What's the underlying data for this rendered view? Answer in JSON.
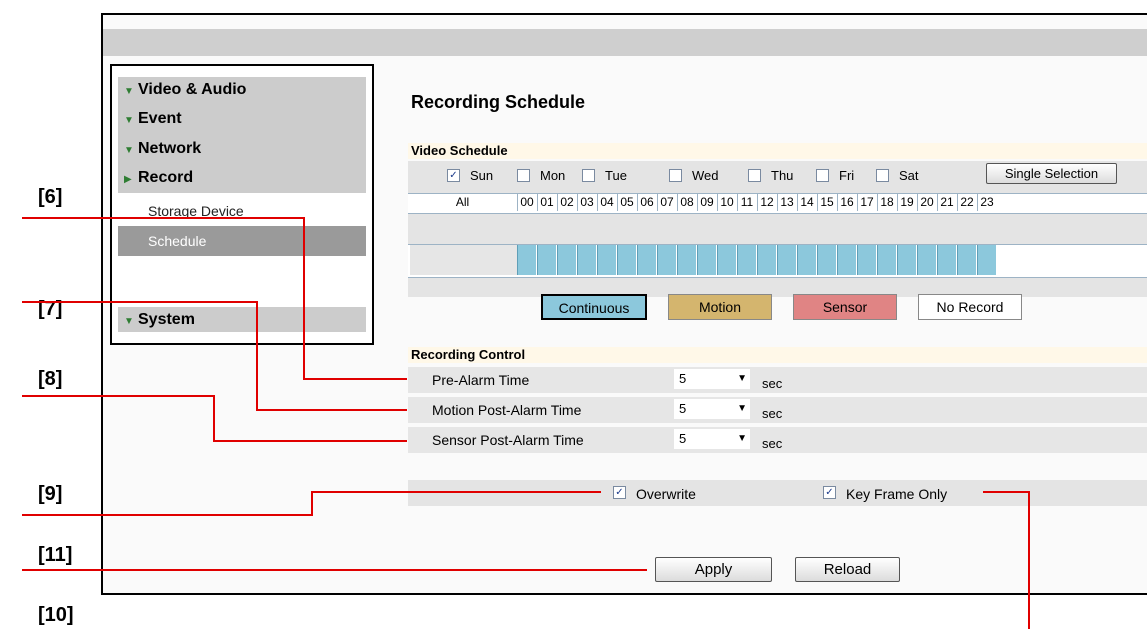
{
  "sidebar": {
    "items": [
      {
        "label": "Video & Audio",
        "icon": "triangle-down-icon"
      },
      {
        "label": "Event",
        "icon": "triangle-down-icon"
      },
      {
        "label": "Network",
        "icon": "triangle-down-icon"
      },
      {
        "label": "Record",
        "icon": "triangle-right-icon"
      },
      {
        "label": "System",
        "icon": "triangle-down-icon"
      }
    ],
    "sub_items": [
      "Storage Device",
      "Schedule"
    ]
  },
  "page": {
    "title": "Recording Schedule"
  },
  "video_schedule": {
    "header": "Video Schedule",
    "days": [
      {
        "label": "Sun",
        "checked": true
      },
      {
        "label": "Mon",
        "checked": false
      },
      {
        "label": "Tue",
        "checked": false
      },
      {
        "label": "Wed",
        "checked": false
      },
      {
        "label": "Thu",
        "checked": false
      },
      {
        "label": "Fri",
        "checked": false
      },
      {
        "label": "Sat",
        "checked": false
      }
    ],
    "single_selection_label": "Single Selection",
    "all_label": "All",
    "hours": [
      "00",
      "01",
      "02",
      "03",
      "04",
      "05",
      "06",
      "07",
      "08",
      "09",
      "10",
      "11",
      "12",
      "13",
      "14",
      "15",
      "16",
      "17",
      "18",
      "19",
      "20",
      "21",
      "22",
      "23"
    ],
    "modes": [
      {
        "label": "Continuous",
        "color": "#8cc8dc",
        "selected": true
      },
      {
        "label": "Motion",
        "color": "#d4b56e",
        "selected": false
      },
      {
        "label": "Sensor",
        "color": "#e08484",
        "selected": false
      },
      {
        "label": "No Record",
        "color": "#ffffff",
        "selected": false
      }
    ]
  },
  "recording_control": {
    "header": "Recording Control",
    "rows": [
      {
        "label": "Pre-Alarm Time",
        "value": "5",
        "unit": "sec"
      },
      {
        "label": "Motion Post-Alarm Time",
        "value": "5",
        "unit": "sec"
      },
      {
        "label": "Sensor Post-Alarm Time",
        "value": "5",
        "unit": "sec"
      }
    ],
    "overwrite_label": "Overwrite",
    "overwrite_checked": true,
    "keyframe_label": "Key Frame Only",
    "keyframe_checked": true
  },
  "buttons": {
    "apply": "Apply",
    "reload": "Reload"
  },
  "callouts": [
    "[6]",
    "[7]",
    "[8]",
    "[9]",
    "[11]",
    "[10]"
  ],
  "colors": {
    "callout_line": "#e00000",
    "schedule_cell": "#8cc8dc"
  }
}
